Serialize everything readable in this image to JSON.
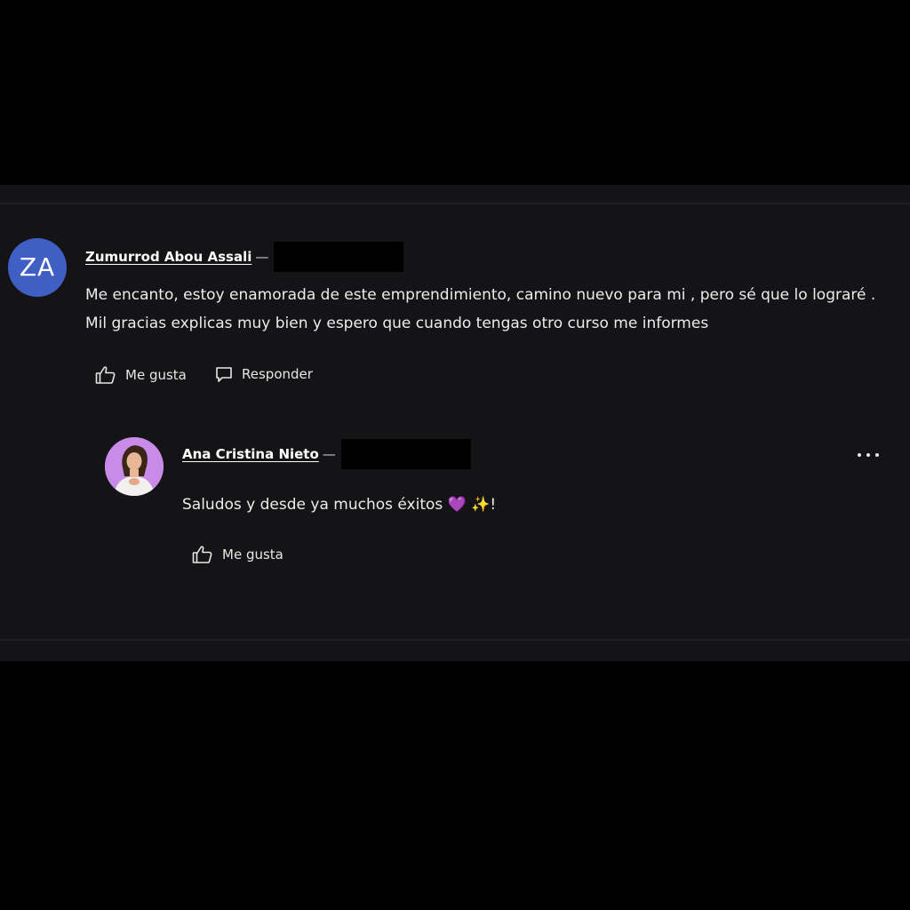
{
  "comment": {
    "avatar_initials": "ZA",
    "author": "Zumurrod Abou Assali",
    "separator": "—",
    "text": "Me encanto, estoy enamorada de  este emprendimiento, camino nuevo para mi , pero sé que lo lograré . Mil gracias explicas muy bien y espero que cuando tengas otro curso me informes",
    "like_label": "Me gusta",
    "reply_label": "Responder"
  },
  "reply": {
    "author": "Ana Cristina Nieto",
    "separator": "—",
    "text": "Saludos y desde ya muchos éxitos",
    "emoji_heart": "💜",
    "emoji_sparkles": "✨",
    "text_end": "!",
    "like_label": "Me gusta",
    "more_icon": "ellipsis-icon"
  },
  "colors": {
    "background": "#000000",
    "panel": "#141416",
    "avatar_bg": "#3f5fc4",
    "reply_avatar_bg": "#c98be8"
  }
}
